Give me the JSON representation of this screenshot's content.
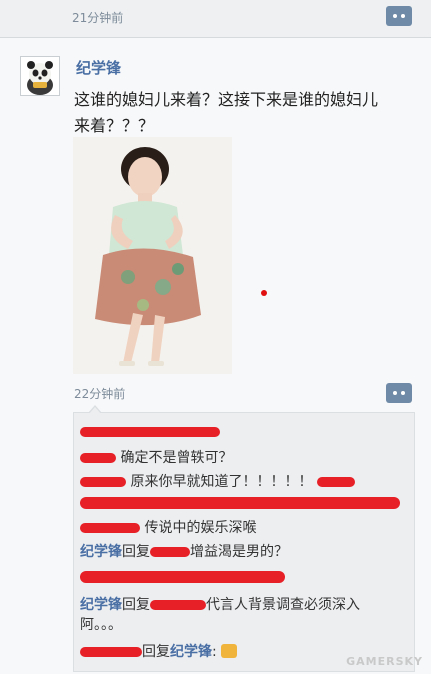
{
  "top": {
    "timestamp": "21分钟前"
  },
  "post": {
    "username": "纪学锋",
    "text_line1": "这谁的媳妇儿来着？这接下来是谁的媳妇儿",
    "text_line2": "来着？？？",
    "timestamp": "22分钟前"
  },
  "comments": [
    {
      "text": "确定不是曾轶可？"
    },
    {
      "text": "原来你早就知道了！！！！！"
    },
    {
      "text": "传说中的娱乐深喉"
    },
    {
      "name": "纪学锋",
      "reply": "回复",
      "text": "增益渴是男的？"
    },
    {
      "name": "纪学锋",
      "reply": "回复",
      "text_line1": "代言人背景调查必须深入",
      "text_line2": "阿。。。"
    },
    {
      "reply": "回复",
      "name": "纪学锋",
      "suffix": ":"
    }
  ],
  "watermark": "GAMERSKY",
  "colors": {
    "link": "#4a6fa5",
    "redaction": "#e6141a",
    "more_button": "#6f8aa6"
  },
  "icons": [
    "more-options-icon",
    "panda-avatar",
    "thumbs-up-icon"
  ]
}
